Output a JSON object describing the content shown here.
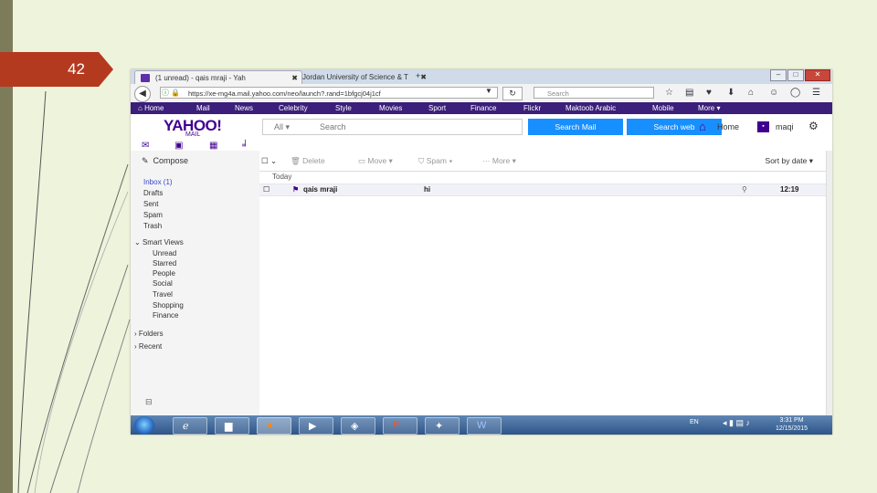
{
  "slide": {
    "number": "42"
  },
  "browser": {
    "tabs": [
      {
        "label": "(1 unread) - qais mraji - Yah",
        "active": true
      },
      {
        "label": "Jordan University of Science & T",
        "active": false
      }
    ],
    "new_tab": "+",
    "url": "https://xe-mg4a.mail.yahoo.com/neo/launch?.rand=1bfgcj04j1cf",
    "search_placeholder": "Search",
    "window_buttons": [
      "–",
      "□",
      "✕"
    ]
  },
  "yahoo_nav": [
    "Home",
    "Mail",
    "News",
    "Celebrity",
    "Style",
    "Movies",
    "Sport",
    "Finance",
    "Flickr",
    "Maktoob Arabic",
    "Mobile",
    "More ▾"
  ],
  "header": {
    "logo": "YAHOO!",
    "logo_sub": "MAIL",
    "search_scope": "All ▾",
    "search_placeholder": "Search",
    "search_mail": "Search Mail",
    "search_web": "Search web",
    "home": "Home",
    "user": "maqi"
  },
  "sidebar": {
    "compose": "Compose",
    "folders": [
      "Inbox (1)",
      "Drafts",
      "Sent",
      "Spam",
      "Trash"
    ],
    "smart_views_header": "Smart Views",
    "smart_views": [
      "Unread",
      "Starred",
      "People",
      "Social",
      "Travel",
      "Shopping",
      "Finance"
    ],
    "folders_header": "Folders",
    "recent_header": "Recent"
  },
  "toolbar": {
    "delete": "Delete",
    "move": "Move ▾",
    "spam": "Spam ▾",
    "more": "More ▾",
    "sort": "Sort by date ▾"
  },
  "messages": {
    "group": "Today",
    "rows": [
      {
        "sender": "qais mraji",
        "subject": "hi",
        "time": "12:19"
      }
    ]
  },
  "taskbar": {
    "language": "EN",
    "time": "3:31 PM",
    "date": "12/15/2015"
  }
}
